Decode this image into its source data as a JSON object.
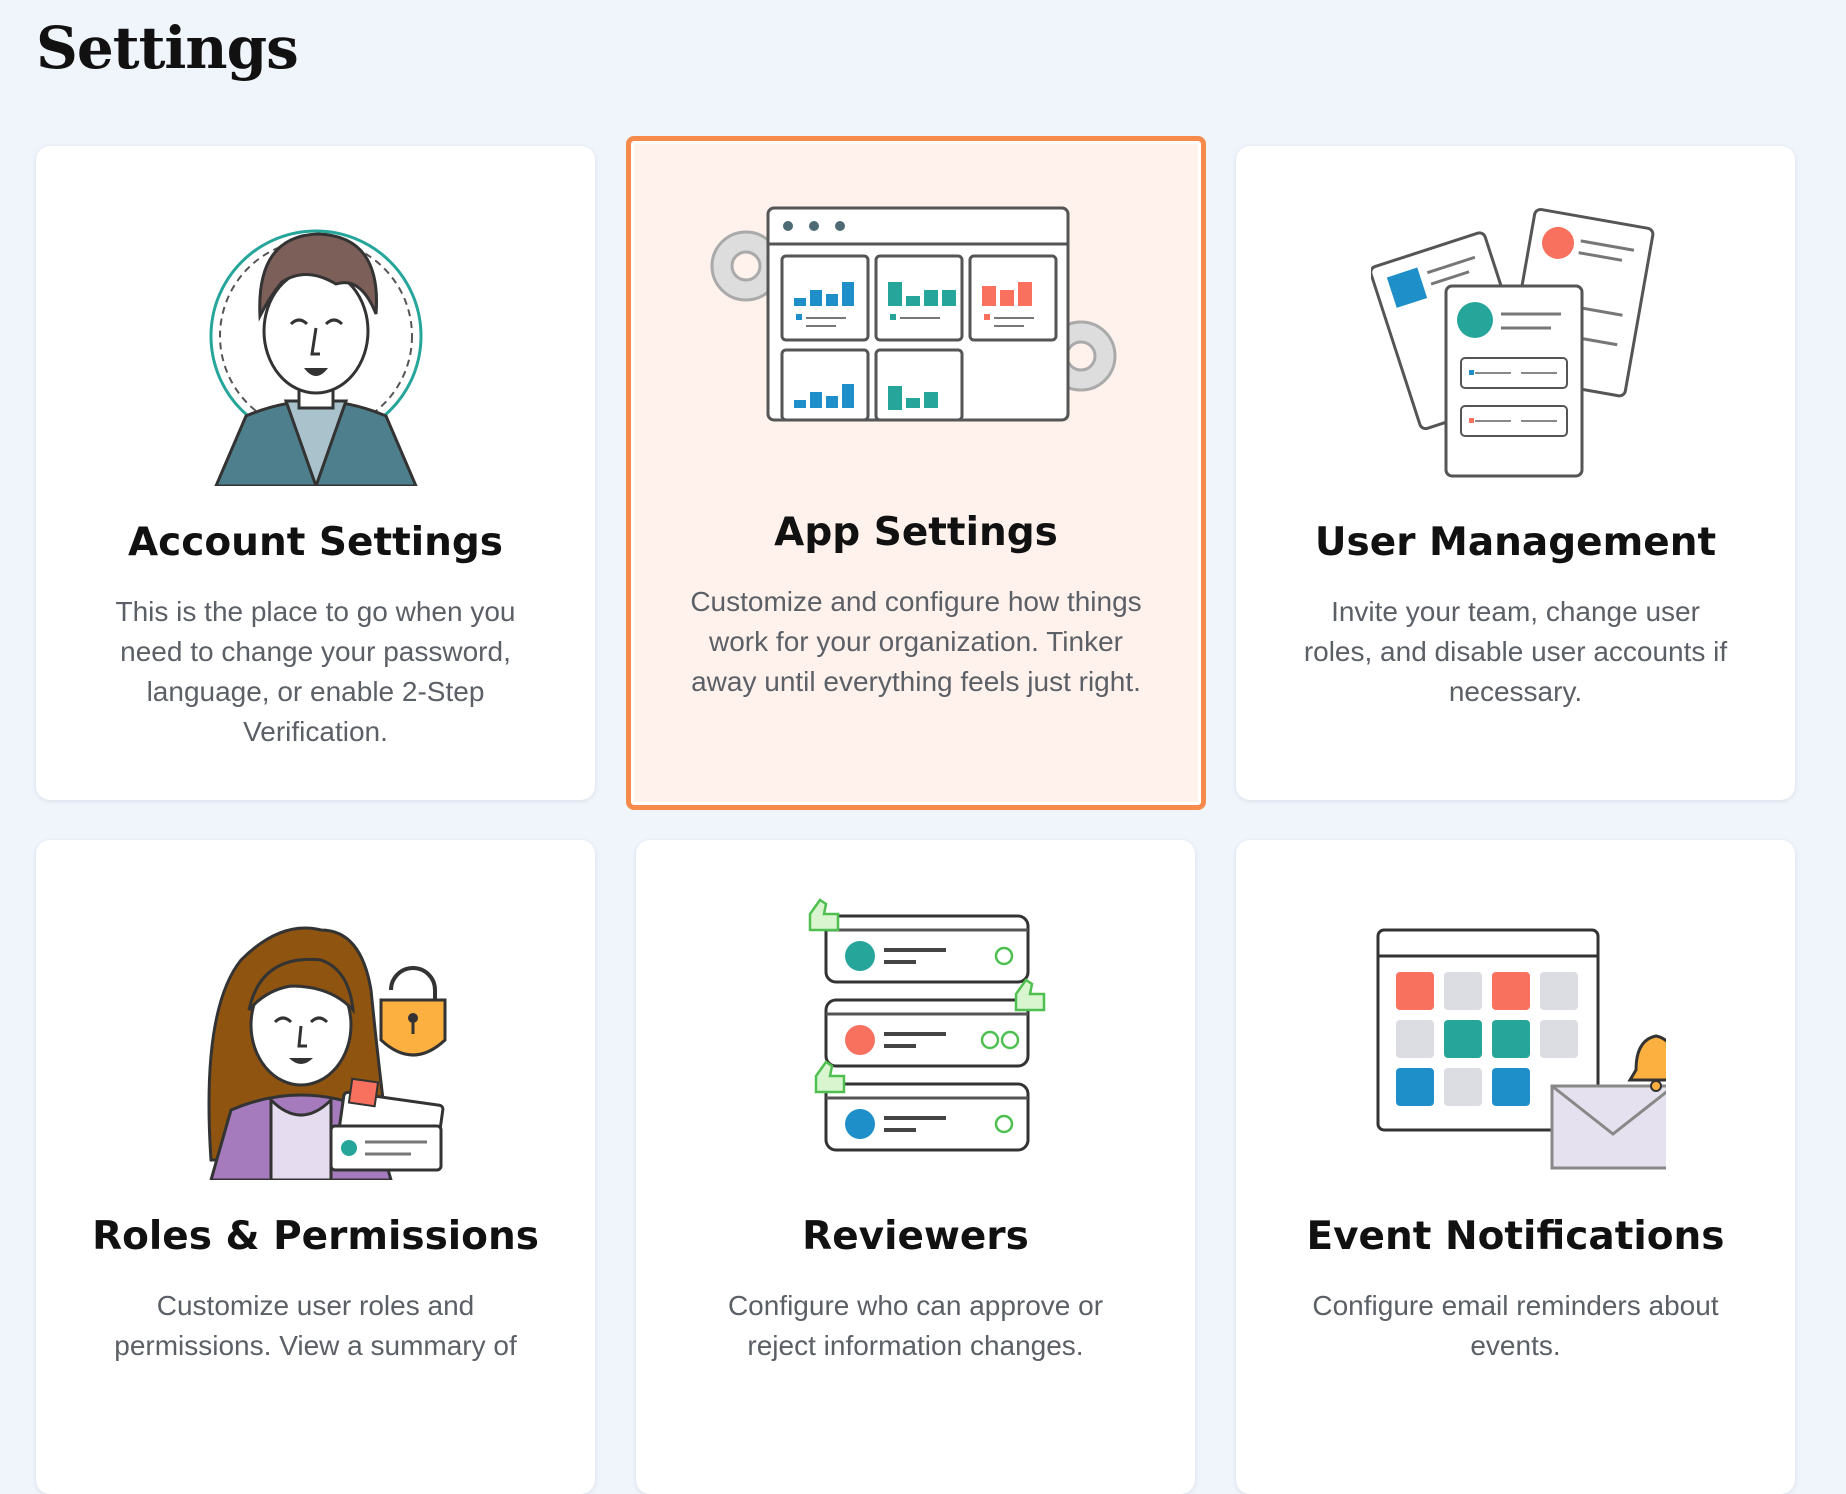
{
  "page": {
    "title": "Settings"
  },
  "cards": [
    {
      "title": "Account Settings",
      "description": "This is the place to go when you need to change your password, language, or enable 2-Step Verification.",
      "icon": "person-avatar-icon"
    },
    {
      "title": "App Settings",
      "description": "Customize and configure how things work for your organization. Tinker away until everything feels just right.",
      "icon": "app-dashboard-icon",
      "selected": true
    },
    {
      "title": "User Management",
      "description": "Invite your team, change user roles, and disable user accounts if necessary.",
      "icon": "user-cards-icon"
    },
    {
      "title": "Roles & Permissions",
      "description": "Customize user roles and permissions. View a summary of",
      "icon": "person-lock-icon"
    },
    {
      "title": "Reviewers",
      "description": "Configure who can approve or reject information changes.",
      "icon": "reviewer-list-icon"
    },
    {
      "title": "Event Notifications",
      "description": "Configure email reminders about events.",
      "icon": "calendar-bell-icon"
    }
  ],
  "colors": {
    "background": "#f0f4fb",
    "selected_border": "#f58a4b",
    "selected_fill": "#fff2ec",
    "teal": "#26a69a",
    "blue": "#1f8fc9",
    "coral": "#f8705e"
  }
}
